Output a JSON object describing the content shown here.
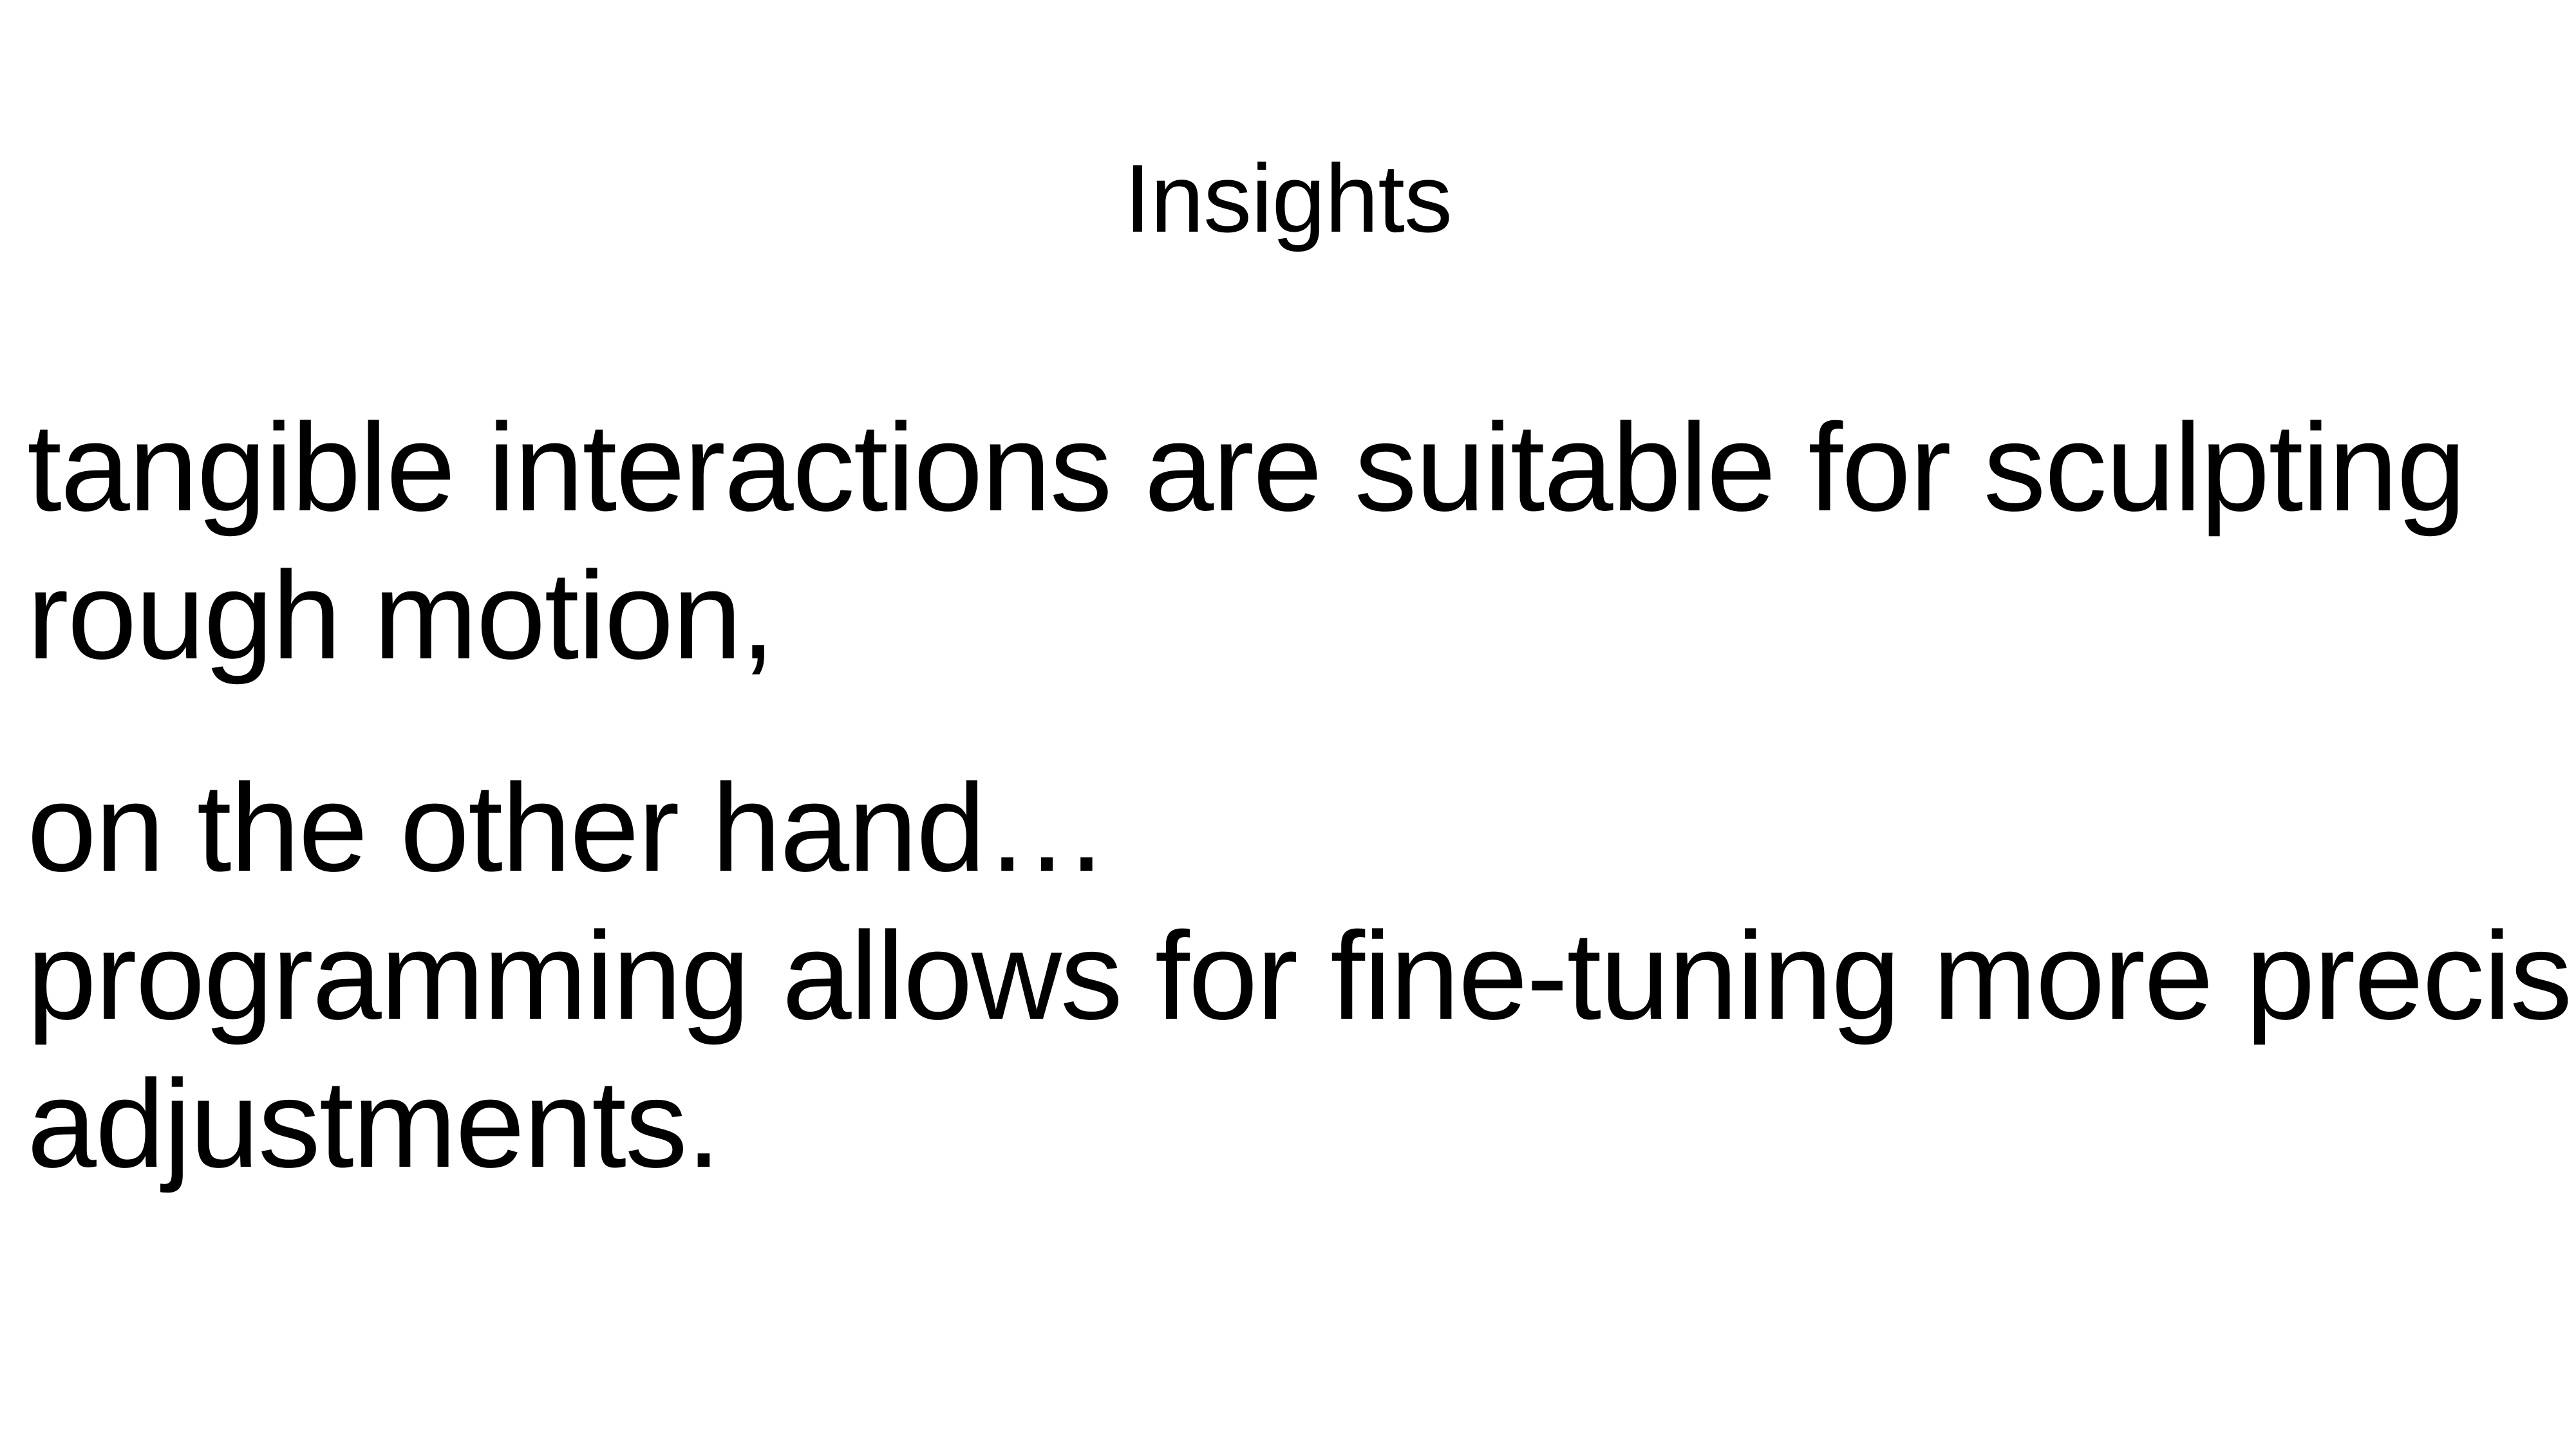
{
  "slide": {
    "title": "Insights",
    "paragraph1": {
      "line1": "tangible interactions are suitable for sculpting",
      "line2": "rough motion,"
    },
    "paragraph2": {
      "line1": "on the other hand…",
      "line2": "programming allows for fine-tuning more precise",
      "line3": "adjustments."
    }
  }
}
